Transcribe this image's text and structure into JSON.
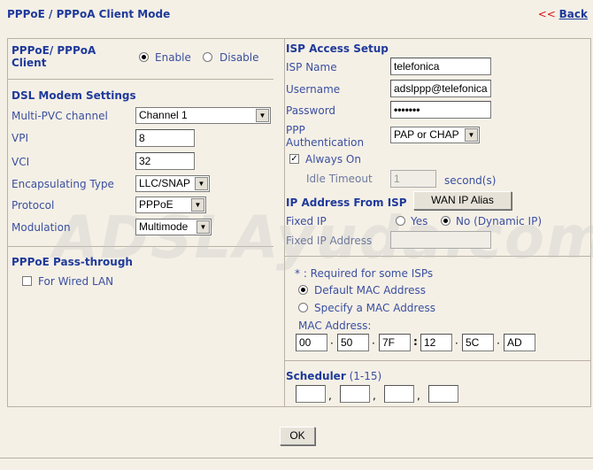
{
  "header": {
    "title": "PPPoE /  PPPoA Client Mode",
    "back_prefix": "<< ",
    "back_label": "Back"
  },
  "left": {
    "client_label": "PPPoE/ PPPoA Client",
    "enable_label": "Enable",
    "disable_label": "Disable",
    "dsl_title": "DSL Modem Settings",
    "multi_pvc_label": "Multi-PVC channel",
    "multi_pvc_value": "Channel 1",
    "vpi_label": "VPI",
    "vpi_value": "8",
    "vci_label": "VCI",
    "vci_value": "32",
    "encap_label": "Encapsulating Type",
    "encap_value": "LLC/SNAP",
    "protocol_label": "Protocol",
    "protocol_value": "PPPoE",
    "modulation_label": "Modulation",
    "modulation_value": "Multimode",
    "passthrough_title": "PPPoE Pass-through",
    "wired_lan_label": "For Wired LAN"
  },
  "right": {
    "isp_title": "ISP Access Setup",
    "isp_name_label": "ISP Name",
    "isp_name_value": "telefonica",
    "username_label": "Username",
    "username_value": "adslppp@telefonica",
    "password_label": "Password",
    "password_value": "•••••••",
    "ppp_auth_label": "PPP Authentication",
    "ppp_auth_value": "PAP or CHAP",
    "always_on_label": "Always On",
    "idle_timeout_label": "Idle Timeout",
    "idle_timeout_value": "1",
    "seconds_label": "second(s)",
    "ip_title": "IP Address From ISP",
    "wan_alias_label": "WAN IP Alias",
    "fixed_ip_label": "Fixed IP",
    "yes_label": "Yes",
    "no_label": "No (Dynamic IP)",
    "fixed_ip_addr_label": "Fixed IP Address",
    "required_note": "* : Required for some ISPs",
    "default_mac_label": "Default MAC Address",
    "specify_mac_label": "Specify a MAC Address",
    "mac_title": "MAC Address:",
    "mac": [
      "00",
      "50",
      "7F",
      "12",
      "5C",
      "AD"
    ],
    "scheduler_title": "Scheduler",
    "scheduler_range": "(1-15)"
  },
  "ok_label": "OK",
  "watermark": "ADSLAyuda.com"
}
